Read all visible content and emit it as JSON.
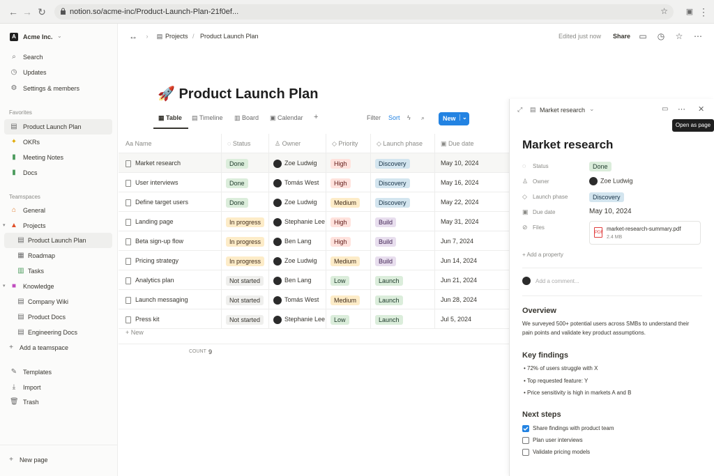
{
  "browser": {
    "url": "notion.so/acme-inc/Product-Launch-Plan-21f0ef..."
  },
  "workspace": {
    "name": "Acme Inc."
  },
  "sidebar": {
    "top": [
      {
        "label": "Search",
        "icon": "search-icon"
      },
      {
        "label": "Updates",
        "icon": "clock-icon"
      },
      {
        "label": "Settings & members",
        "icon": "gear-icon"
      }
    ],
    "favorites_heading": "Favorites",
    "favorites": [
      {
        "label": "Product Launch Plan",
        "icon": "doc-icon"
      },
      {
        "label": "OKRs",
        "icon": "star-icon"
      },
      {
        "label": "Meeting Notes",
        "icon": "green-doc-icon"
      },
      {
        "label": "Docs",
        "icon": "green-doc-icon"
      }
    ],
    "teamspaces_heading": "Teamspaces",
    "teamspaces": [
      {
        "label": "General"
      },
      {
        "label": "Projects"
      },
      {
        "label": "Product Launch Plan"
      },
      {
        "label": "Roadmap"
      },
      {
        "label": "Tasks"
      },
      {
        "label": "Knowledge"
      },
      {
        "label": "Company Wiki"
      },
      {
        "label": "Product Docs"
      },
      {
        "label": "Engineering Docs"
      },
      {
        "label": "Add a teamspace"
      }
    ],
    "bottom": [
      {
        "label": "Templates"
      },
      {
        "label": "Import"
      },
      {
        "label": "Trash"
      }
    ],
    "new_page": "New page"
  },
  "topbar": {
    "breadcrumb": [
      "Projects",
      "Product Launch Plan"
    ],
    "separator": "/",
    "edited": "Edited just now",
    "share": "Share"
  },
  "page": {
    "emoji": "🚀",
    "title": "Product Launch Plan"
  },
  "views": {
    "tabs": [
      "Table",
      "Timeline",
      "Board",
      "Calendar"
    ],
    "add": "+",
    "filter": "Filter",
    "sort": "Sort",
    "new": "New"
  },
  "table": {
    "columns": [
      "Name",
      "Status",
      "Owner",
      "Priority",
      "Launch phase",
      "Due date"
    ],
    "rows": [
      {
        "name": "Market research",
        "status": "Done",
        "owner": "Zoe Ludwig",
        "priority": "High",
        "phase": "Discovery",
        "due": "May 10, 2024"
      },
      {
        "name": "User interviews",
        "status": "Done",
        "owner": "Tomás West",
        "priority": "High",
        "phase": "Discovery",
        "due": "May 16, 2024"
      },
      {
        "name": "Define target users",
        "status": "Done",
        "owner": "Zoe Ludwig",
        "priority": "Medium",
        "phase": "Discovery",
        "due": "May 22, 2024"
      },
      {
        "name": "Landing page",
        "status": "In progress",
        "owner": "Stephanie Lee",
        "priority": "High",
        "phase": "Build",
        "due": "May 31, 2024"
      },
      {
        "name": "Beta sign-up flow",
        "status": "In progress",
        "owner": "Ben Lang",
        "priority": "High",
        "phase": "Build",
        "due": "Jun 7, 2024"
      },
      {
        "name": "Pricing strategy",
        "status": "In progress",
        "owner": "Zoe Ludwig",
        "priority": "Medium",
        "phase": "Build",
        "due": "Jun 14, 2024"
      },
      {
        "name": "Analytics plan",
        "status": "Not started",
        "owner": "Ben Lang",
        "priority": "Low",
        "phase": "Launch",
        "due": "Jun 21, 2024"
      },
      {
        "name": "Launch messaging",
        "status": "Not started",
        "owner": "Tomás West",
        "priority": "Medium",
        "phase": "Launch",
        "due": "Jun 28, 2024"
      },
      {
        "name": "Press kit",
        "status": "Not started",
        "owner": "Stephanie Lee",
        "priority": "Low",
        "phase": "Launch",
        "due": "Jul 5, 2024"
      }
    ],
    "new_row": "New",
    "count_label": "COUNT",
    "count_value": "9"
  },
  "colors": {
    "Done": [
      "#dbeddb",
      "#1c3829"
    ],
    "In progress": [
      "#fdecc8",
      "#402c1b"
    ],
    "Not started": [
      "#efefed",
      "#37352f"
    ],
    "High": [
      "#ffe2dd",
      "#5d1715"
    ],
    "Medium": [
      "#fdecc8",
      "#402c1b"
    ],
    "Low": [
      "#dbeddb",
      "#1c3829"
    ],
    "Discovery": [
      "#d3e5ef",
      "#183347"
    ],
    "Build": [
      "#e8deee",
      "#412454"
    ],
    "Launch": [
      "#dbeddb",
      "#1c3829"
    ],
    "accent": "#2383e2"
  },
  "panel": {
    "breadcrumb": "Market research",
    "tooltip": "Open as page",
    "title": "Market research",
    "props": {
      "status_label": "Status",
      "status": "Done",
      "owner_label": "Owner",
      "owner": "Zoe Ludwig",
      "phase_label": "Launch phase",
      "phase": "Discovery",
      "due_label": "Due date",
      "due": "May 10, 2024",
      "files_label": "Files",
      "file_name": "market-research-summary.pdf",
      "file_size": "2.4 MB"
    },
    "add_property": "Add a property",
    "add_comment": "Add a comment...",
    "overview_heading": "Overview",
    "overview_text1": "We surveyed 500+ potential users across SMBs to understand their",
    "overview_text2": "pain points and validate key product assumptions.",
    "findings_heading": "Key findings",
    "findings": [
      "72% of users struggle with X",
      "Top requested feature: Y",
      "Price sensitivity is high in markets A and B"
    ],
    "next_heading": "Next steps",
    "next": [
      {
        "label": "Share findings with product team",
        "checked": true
      },
      {
        "label": "Plan user interviews",
        "checked": false
      },
      {
        "label": "Validate pricing models",
        "checked": false
      }
    ]
  }
}
